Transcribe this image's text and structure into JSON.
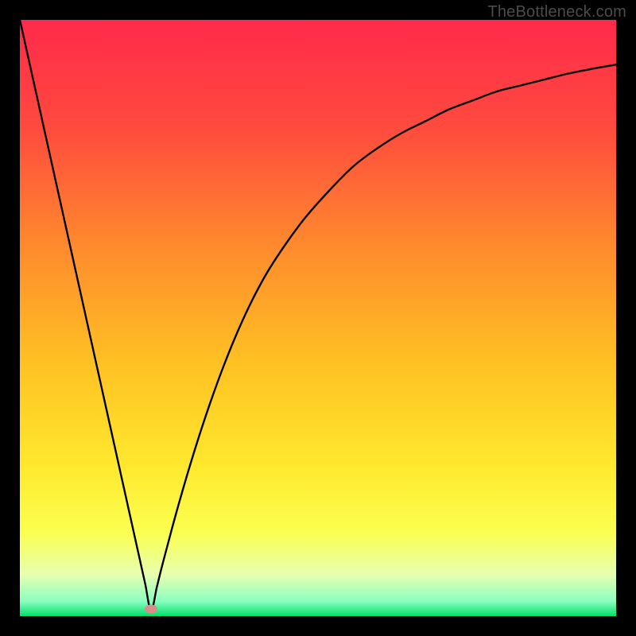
{
  "credit": "TheBottleneck.com",
  "colors": {
    "frame": "#000000",
    "credit_text": "#4b4b4b",
    "curve": "#000000",
    "marker": "#d98e89",
    "gradient_stops": [
      {
        "offset": 0.0,
        "color": "#ff2a4b"
      },
      {
        "offset": 0.18,
        "color": "#ff4a3e"
      },
      {
        "offset": 0.38,
        "color": "#ff8a2d"
      },
      {
        "offset": 0.58,
        "color": "#ffc223"
      },
      {
        "offset": 0.75,
        "color": "#ffe92e"
      },
      {
        "offset": 0.86,
        "color": "#fbff50"
      },
      {
        "offset": 0.93,
        "color": "#e8ffb0"
      },
      {
        "offset": 0.975,
        "color": "#8affc0"
      },
      {
        "offset": 1.0,
        "color": "#00e06a"
      }
    ]
  },
  "chart_data": {
    "type": "line",
    "title": "",
    "xlabel": "",
    "ylabel": "",
    "xlim": [
      0,
      100
    ],
    "ylim": [
      0,
      100
    ],
    "grid": false,
    "legend": false,
    "marker": {
      "x": 22,
      "y": 1.2
    },
    "x": [
      0,
      2,
      4,
      6,
      8,
      10,
      12,
      14,
      16,
      18,
      20,
      21,
      22,
      23,
      24,
      26,
      28,
      30,
      32,
      34,
      36,
      38,
      40,
      42,
      45,
      48,
      52,
      56,
      60,
      64,
      68,
      72,
      76,
      80,
      84,
      88,
      92,
      96,
      100
    ],
    "values": [
      100,
      91,
      82,
      73,
      64,
      55,
      46,
      37,
      28,
      19,
      10,
      5.5,
      1,
      5,
      9,
      16.5,
      23.5,
      30,
      36,
      41.5,
      46.5,
      51,
      55,
      58.5,
      63,
      67,
      71.5,
      75.5,
      78.5,
      81,
      83,
      85,
      86.5,
      88,
      89,
      90,
      91,
      91.8,
      92.5
    ]
  }
}
